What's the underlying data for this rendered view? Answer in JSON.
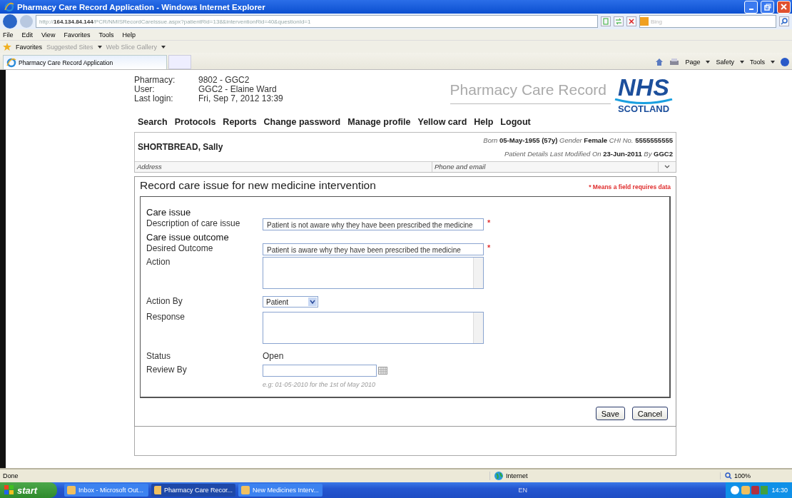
{
  "window": {
    "title": "Pharmacy Care Record Application - Windows Internet Explorer"
  },
  "address_bar": {
    "url": "http://**164.134.84.144**/PCR/NMISRecordCareIssue.aspx?patientRid=138&interventionRid=40&questionId=1",
    "search_placeholder": "Bing"
  },
  "menu_bar": [
    "File",
    "Edit",
    "View",
    "Favorites",
    "Tools",
    "Help"
  ],
  "favorites_bar": {
    "label": "Favorites",
    "items": [
      "Suggested Sites",
      "Web Slice Gallery"
    ]
  },
  "tabs": [
    {
      "label": "Pharmacy Care Record Application",
      "selected": true
    }
  ],
  "command_bar": [
    "Page",
    "Safety",
    "Tools"
  ],
  "header": {
    "fields": [
      {
        "label": "Pharmacy:",
        "value": "9802 - GGC2"
      },
      {
        "label": "User:",
        "value": "GGC2 - Elaine Ward"
      },
      {
        "label": "Last login:",
        "value": "Fri, Sep 7, 2012 13:39"
      }
    ],
    "app_title": "Pharmacy Care Record",
    "logo_main": "NHS",
    "logo_sub": "SCOTLAND"
  },
  "nav": [
    "Search",
    "Protocols",
    "Reports",
    "Change password",
    "Manage profile",
    "Yellow card",
    "Help",
    "Logout"
  ],
  "patient": {
    "name": "SHORTBREAD, Sally",
    "details": "*Born* **05-May-1955 (57y)** *Gender* **Female** *CHI No.* **5555555555**",
    "modified": "*Patient Details Last Modified On* **23-Jun-2011** *By* **GGC2**",
    "address_label": "Address",
    "contact_label": "Phone and email"
  },
  "form": {
    "title": "Record care issue for new medicine intervention",
    "required_note": "* Means a field requires data",
    "rows": [
      {
        "kind": "heading",
        "label": "Care issue"
      },
      {
        "kind": "text",
        "label": "Description of care issue",
        "value": "Patient is not aware why they have been prescribed the medicine",
        "required_mark": "*"
      },
      {
        "kind": "heading",
        "label": "Care issue outcome"
      },
      {
        "kind": "text",
        "label": "Desired Outcome",
        "value": "Patient is aware why they have been prescribed the medicine",
        "required_mark": "*"
      },
      {
        "kind": "textarea",
        "label": "Action"
      },
      {
        "kind": "select",
        "label": "Action By",
        "value": "Patient"
      },
      {
        "kind": "textarea",
        "label": "Response"
      },
      {
        "kind": "static",
        "label": "Status",
        "value": "Open"
      },
      {
        "kind": "date",
        "label": "Review By",
        "hint": "e.g: 01-05-2010 for the 1st of May 2010"
      }
    ],
    "buttons": [
      "Save",
      "Cancel"
    ]
  },
  "status_bar": {
    "text": "Done",
    "zone": "Internet",
    "zoom": "100%"
  },
  "taskbar": {
    "start": "start",
    "items": [
      {
        "label": "Inbox - Microsoft Out...",
        "selected": false
      },
      {
        "label": "Pharmacy Care Recor...",
        "selected": true
      },
      {
        "label": "New Medicines Interv...",
        "selected": false
      }
    ],
    "language": "EN",
    "clock": "14:30"
  }
}
